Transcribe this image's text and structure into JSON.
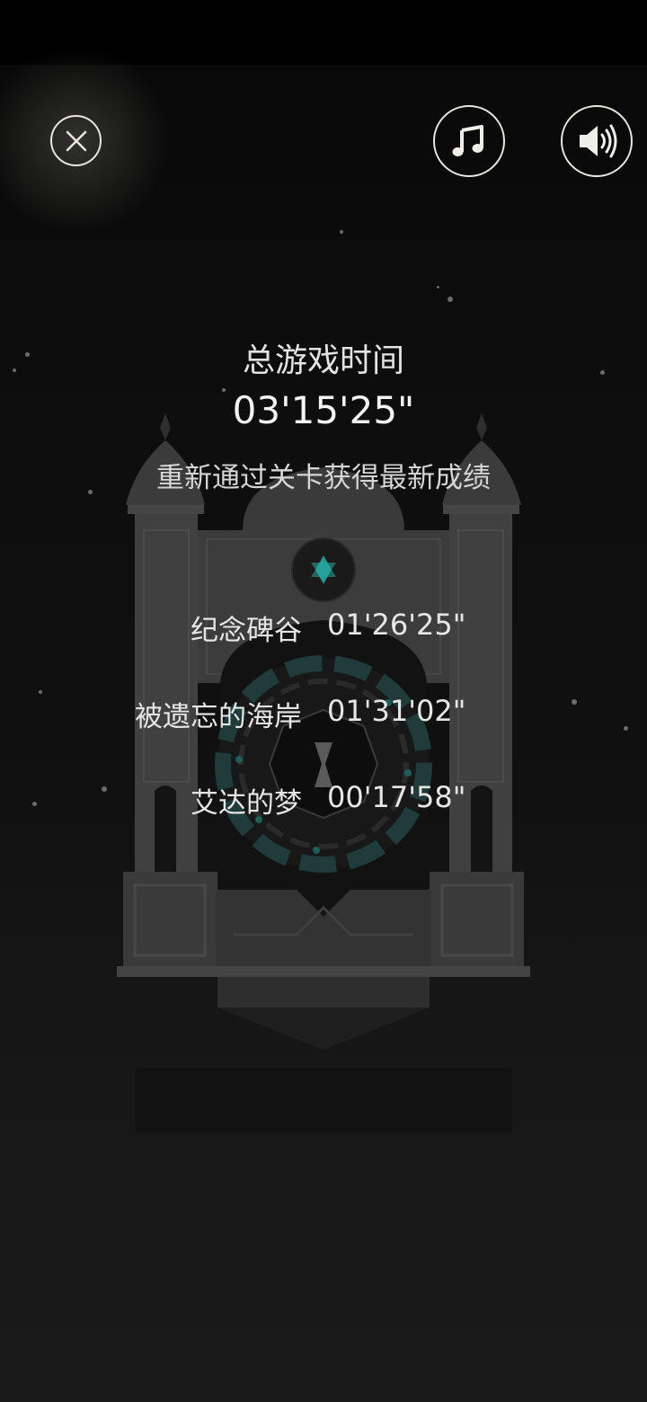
{
  "header": {
    "close_icon": "close-x-icon",
    "music_icon": "music-note-icon",
    "sound_icon": "speaker-volume-icon"
  },
  "summary": {
    "title": "总游戏时间",
    "total_time": "03'15'25\"",
    "hint": "重新通过关卡获得最新成绩"
  },
  "levels": [
    {
      "name": "纪念碑谷",
      "time": "01'26'25\""
    },
    {
      "name": "被遗忘的海岸",
      "time": "01'31'02\""
    },
    {
      "name": "艾达的梦",
      "time": "00'17'58\""
    }
  ],
  "colors": {
    "background": "#0c0c0c",
    "monument": "#3a3a3a",
    "accent_teal": "#2aa7a0",
    "text": "#ebebeb"
  }
}
